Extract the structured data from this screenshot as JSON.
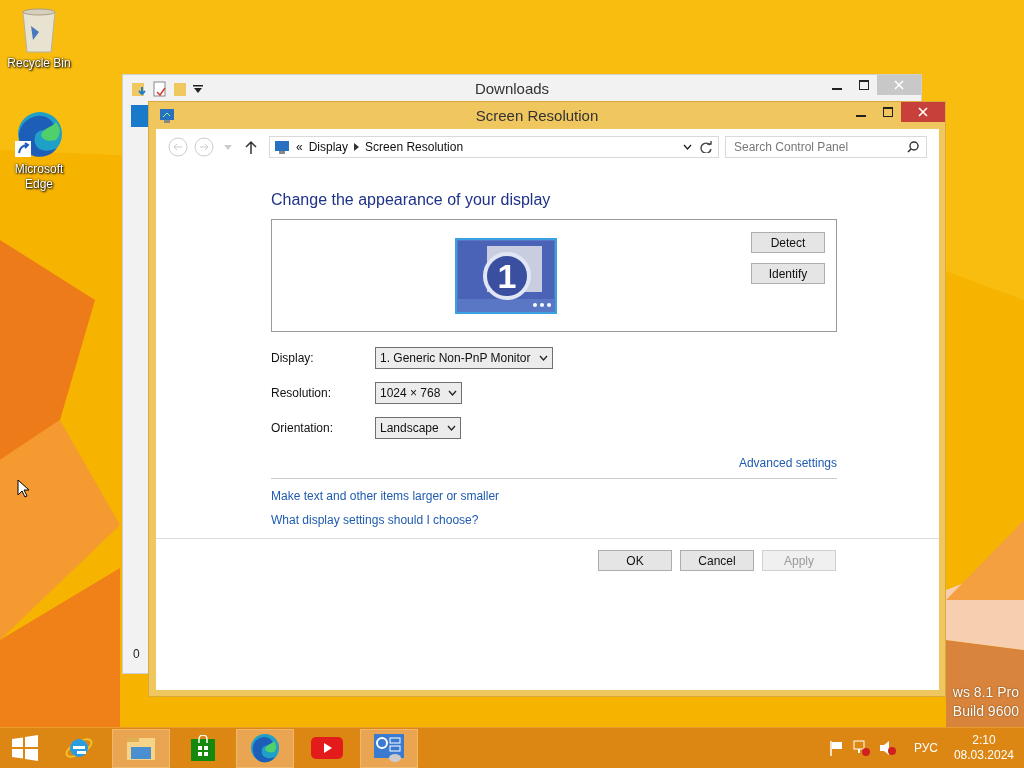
{
  "desktop": {
    "icons": [
      {
        "kind": "recycle-bin",
        "label": "Recycle Bin"
      },
      {
        "kind": "edge",
        "label": "Microsoft Edge"
      }
    ],
    "edition_text": [
      "ws 8.1 Pro",
      "Build 9600"
    ]
  },
  "background_window": {
    "title": "Downloads",
    "status": "0"
  },
  "window": {
    "title": "Screen Resolution",
    "address": {
      "overflow": "«",
      "crumbs": [
        "Display",
        "Screen Resolution"
      ]
    },
    "search": {
      "placeholder": "Search Control Panel"
    },
    "heading": "Change the appearance of your display",
    "preview": {
      "monitor_number": "1",
      "buttons": [
        "Detect",
        "Identify"
      ]
    },
    "settings": [
      {
        "label": "Display:",
        "value": "1. Generic Non-PnP Monitor"
      },
      {
        "label": "Resolution:",
        "value": "1024 × 768"
      },
      {
        "label": "Orientation:",
        "value": "Landscape"
      }
    ],
    "advanced_link": "Advanced settings",
    "links": [
      "Make text and other items larger or smaller",
      "What display settings should I choose?"
    ],
    "buttons": [
      {
        "label": "OK",
        "disabled": false
      },
      {
        "label": "Cancel",
        "disabled": false
      },
      {
        "label": "Apply",
        "disabled": true
      }
    ]
  },
  "taskbar": {
    "apps": [
      {
        "kind": "ie",
        "running": false
      },
      {
        "kind": "explorer",
        "running": true
      },
      {
        "kind": "store",
        "running": false
      },
      {
        "kind": "edge",
        "running": true
      },
      {
        "kind": "youtube",
        "running": false
      },
      {
        "kind": "control-panel",
        "running": true
      }
    ],
    "language": "РУС",
    "time": "2:10",
    "date": "08.03.2024"
  }
}
